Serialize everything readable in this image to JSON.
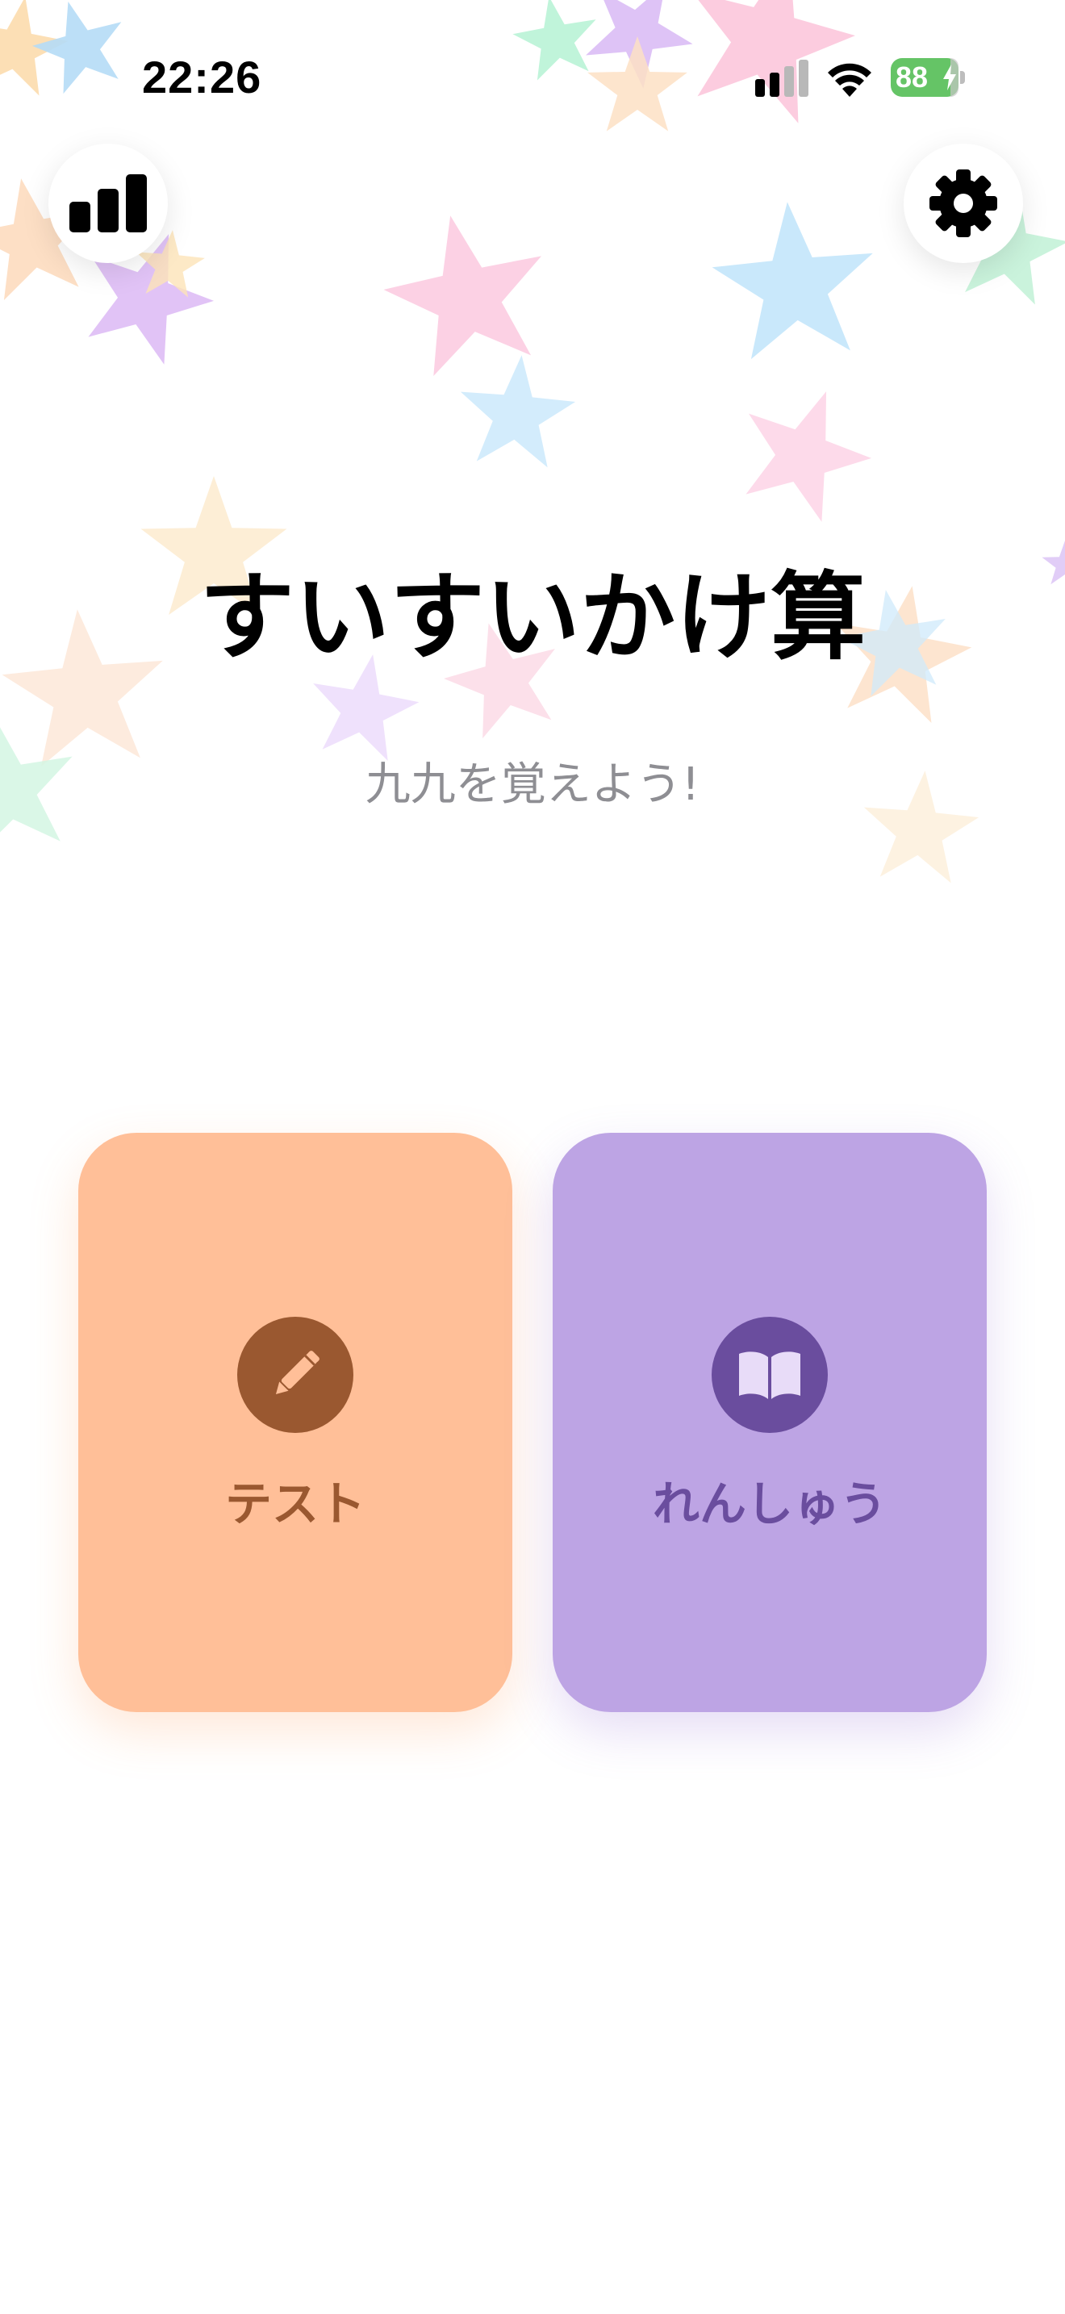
{
  "status_bar": {
    "time": "22:26",
    "battery_percent": "88",
    "battery_charging": true,
    "battery_color": "#65c466"
  },
  "toolbar": {
    "stats_icon": "bar-chart-icon",
    "settings_icon": "gear-icon"
  },
  "header": {
    "title": "すいすいかけ算",
    "subtitle": "九九を覚えよう!"
  },
  "modes": [
    {
      "label": "テスト",
      "icon": "pencil-icon",
      "background": "#ffbf98",
      "accent": "#9a5830"
    },
    {
      "label": "れんしゅう",
      "icon": "book-icon",
      "background": "#bda4e4",
      "accent": "#6a4d9e"
    }
  ]
}
